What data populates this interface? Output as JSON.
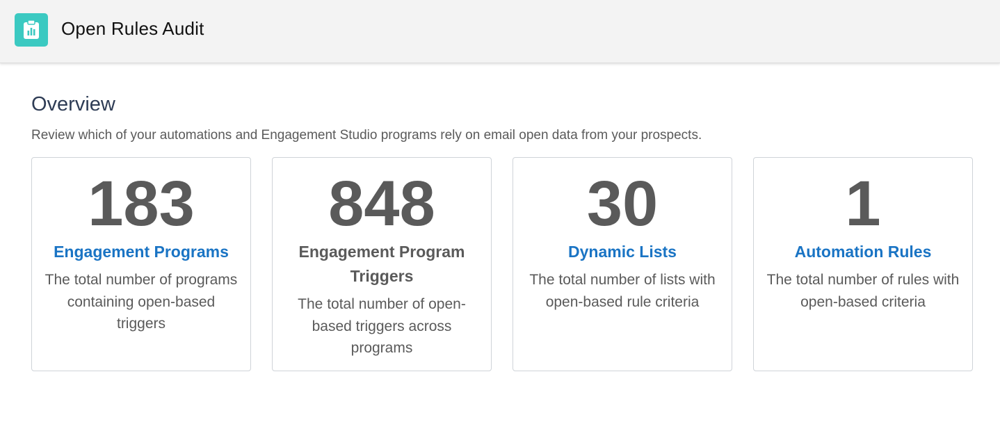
{
  "header": {
    "title": "Open Rules Audit",
    "icon": "clipboard-chart-icon",
    "icon_color": "#3bc9c1"
  },
  "overview": {
    "title": "Overview",
    "description": "Review which of your automations and Engagement Studio programs rely on email open data from your prospects."
  },
  "colors": {
    "link": "#1a74c4",
    "number": "#5a5a5a",
    "text": "#5a5a5a"
  },
  "cards": [
    {
      "number": "183",
      "label": "Engagement Programs",
      "label_is_link": true,
      "description": "The total number of programs containing open-based triggers"
    },
    {
      "number": "848",
      "label": "Engagement Program Triggers",
      "label_is_link": false,
      "description": "The total number of open-based triggers across programs"
    },
    {
      "number": "30",
      "label": "Dynamic Lists",
      "label_is_link": true,
      "description": "The total number of lists with open-based rule criteria"
    },
    {
      "number": "1",
      "label": "Automation Rules",
      "label_is_link": true,
      "description": "The total number of rules with open-based criteria"
    }
  ]
}
